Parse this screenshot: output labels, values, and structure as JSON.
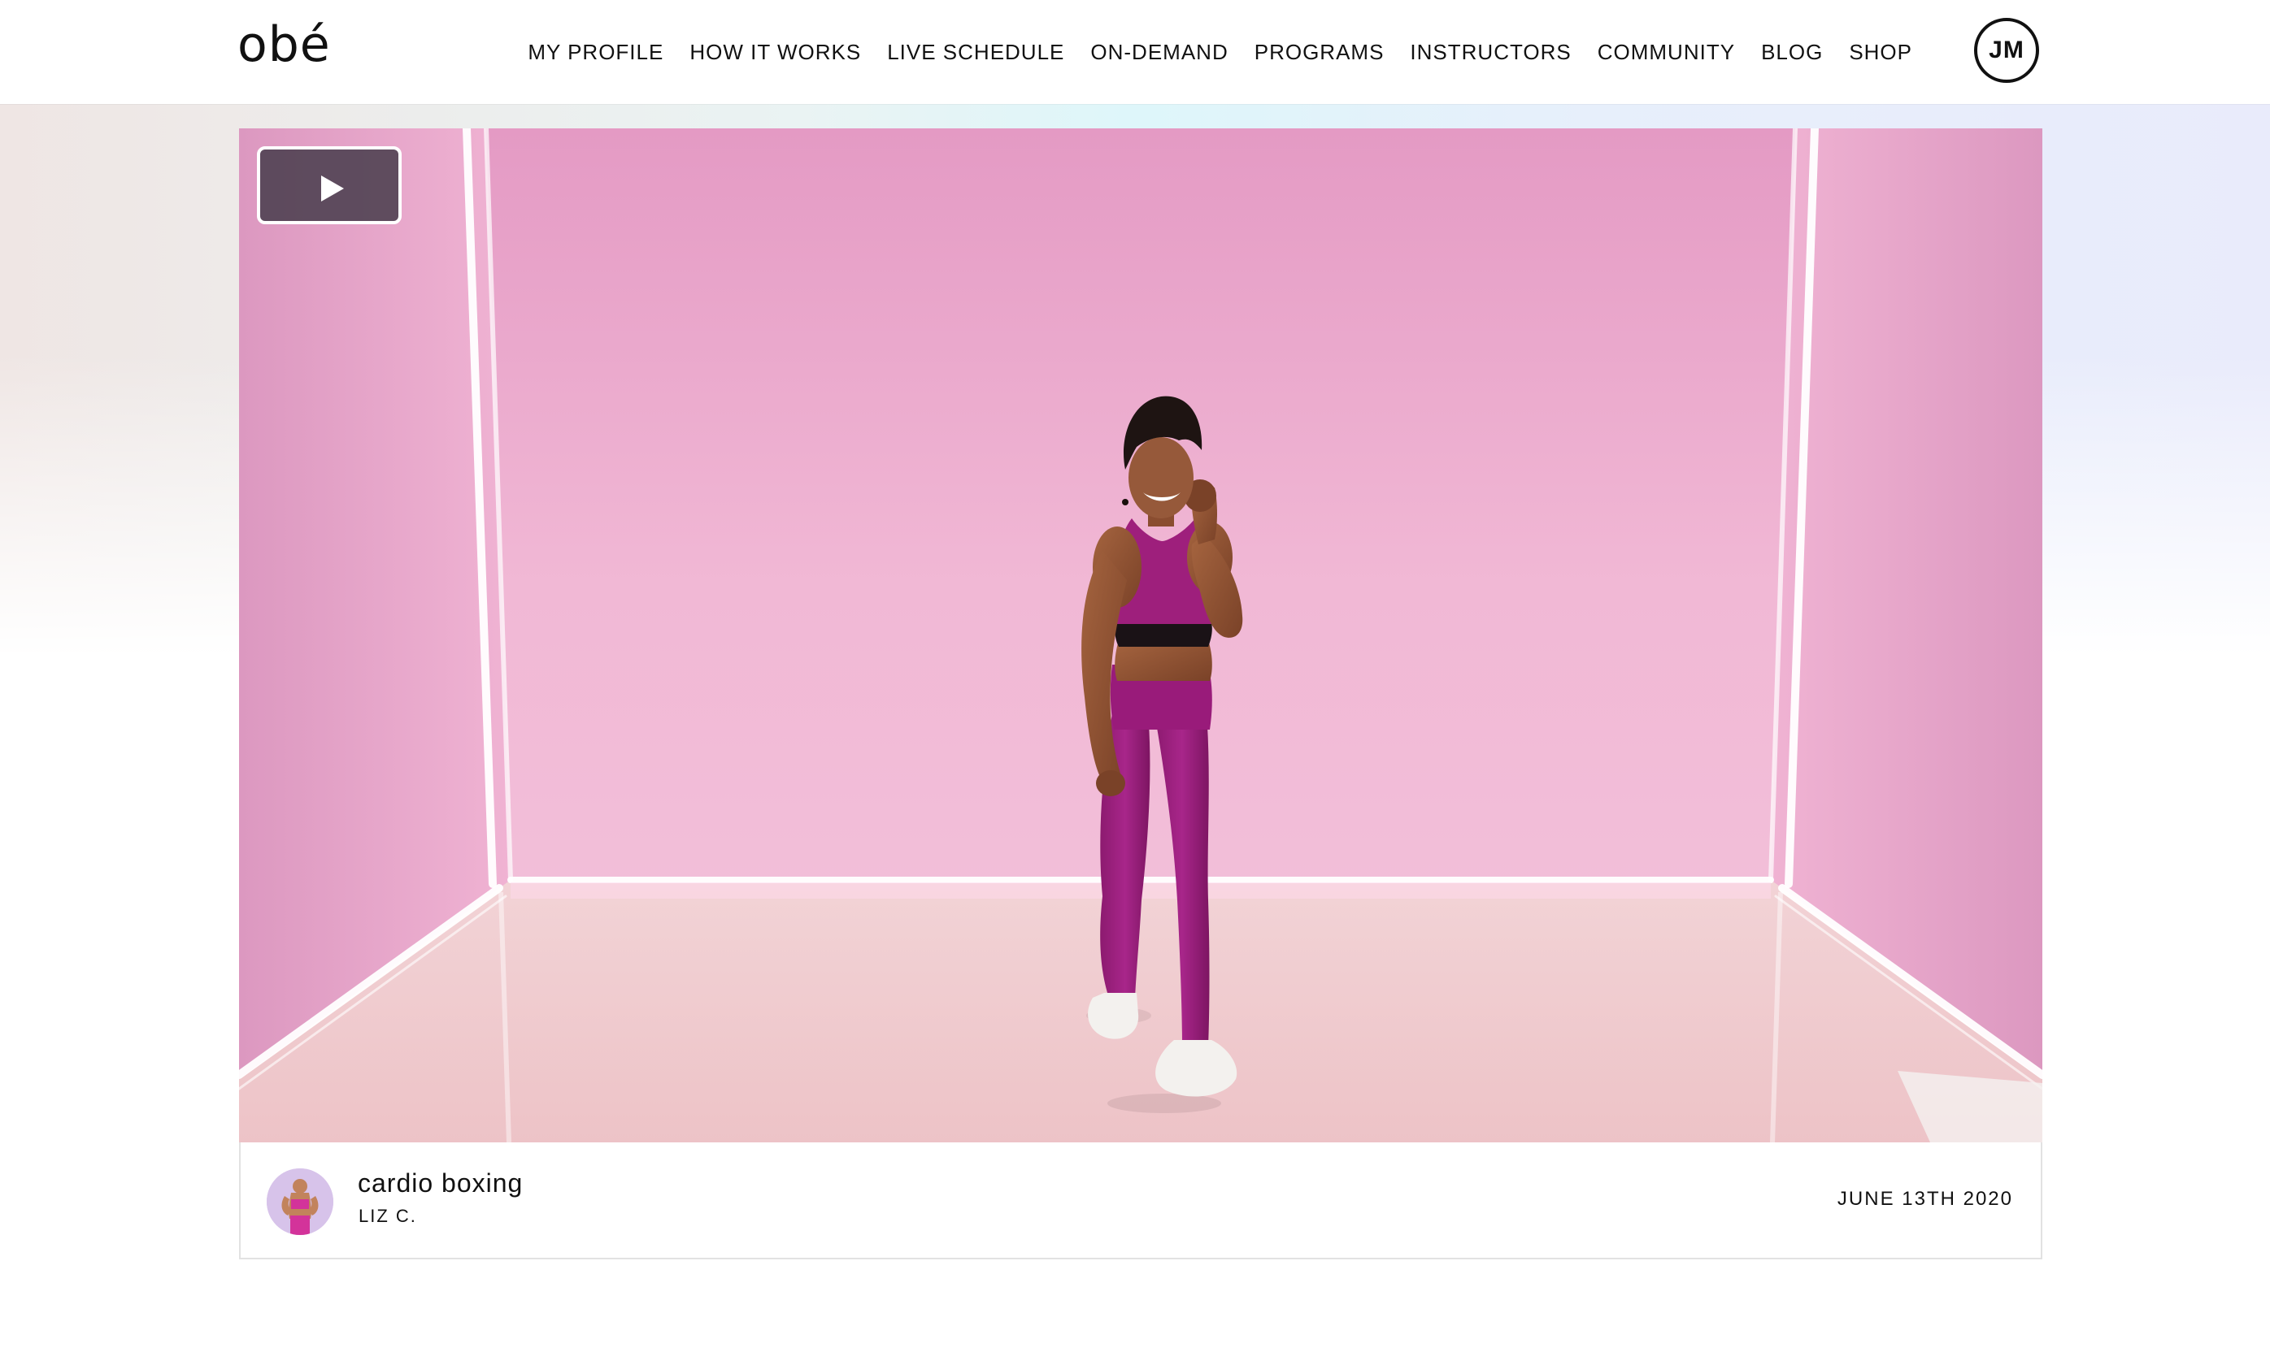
{
  "header": {
    "logo": "obé",
    "nav": [
      {
        "label": "MY PROFILE"
      },
      {
        "label": "HOW IT WORKS"
      },
      {
        "label": "LIVE SCHEDULE"
      },
      {
        "label": "ON-DEMAND"
      },
      {
        "label": "PROGRAMS"
      },
      {
        "label": "INSTRUCTORS"
      },
      {
        "label": "COMMUNITY"
      },
      {
        "label": "BLOG"
      },
      {
        "label": "SHOP"
      }
    ],
    "user_initials": "JM"
  },
  "video": {
    "play_icon": "play-icon",
    "scene_description_colors": {
      "wall": "#f1b8d5",
      "floor": "#efc9cd",
      "outfit": "#9e1f7c"
    }
  },
  "class_info": {
    "title": "cardio boxing",
    "instructor": "LIZ C.",
    "date": "JUNE 13TH 2020"
  },
  "colors": {
    "accent_pink": "#f1b8d5",
    "text": "#111111",
    "card_border": "#e2e2e2"
  }
}
